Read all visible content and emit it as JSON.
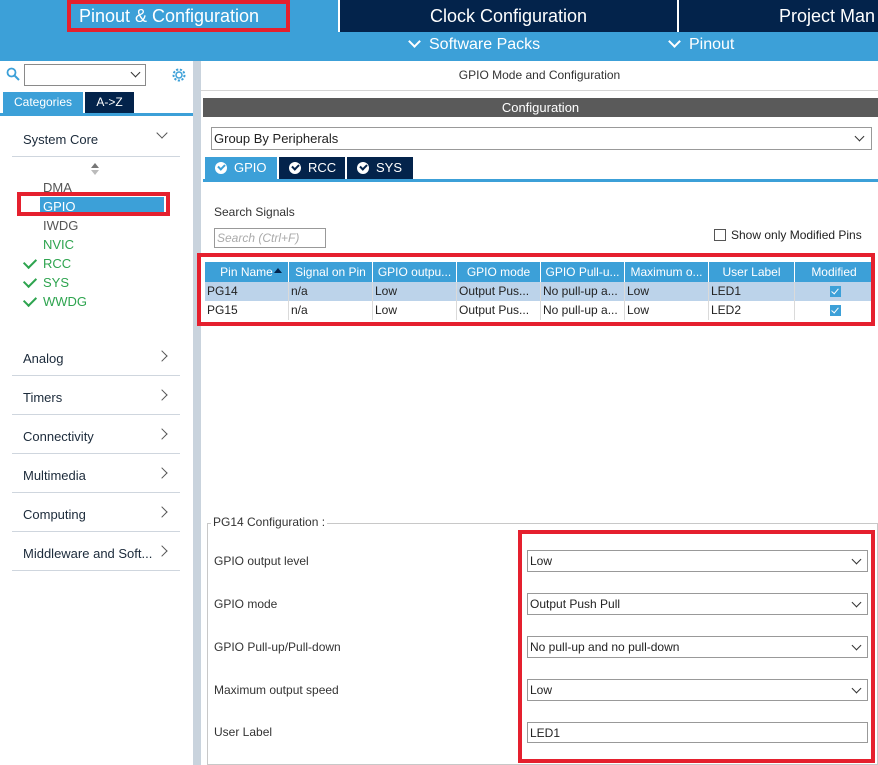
{
  "top_tabs": [
    {
      "label": "Pinout & Configuration"
    },
    {
      "label": "Clock Configuration"
    },
    {
      "label": "Project Man"
    }
  ],
  "sub_menu": {
    "software_packs": "Software Packs",
    "pinout": "Pinout"
  },
  "left_panel": {
    "search_value": "",
    "tab_categories": "Categories",
    "tab_az": "A->Z",
    "system_core": "System Core",
    "system_core_items": [
      "DMA",
      "GPIO",
      "IWDG",
      "NVIC",
      "RCC",
      "SYS",
      "WWDG"
    ],
    "sections": [
      "Analog",
      "Timers",
      "Connectivity",
      "Multimedia",
      "Computing",
      "Middleware and Soft..."
    ]
  },
  "right_panel": {
    "title": "GPIO Mode and Configuration",
    "config_header": "Configuration",
    "group_by": "Group By Peripherals",
    "peripheral_tabs": [
      "GPIO",
      "RCC",
      "SYS"
    ],
    "search_signals_label": "Search Signals",
    "search_placeholder": "Search (Ctrl+F)",
    "show_modified_label": "Show only Modified Pins",
    "table": {
      "headers": [
        "Pin Name",
        "Signal on Pin",
        "GPIO outpu...",
        "GPIO mode",
        "GPIO Pull-u...",
        "Maximum o...",
        "User Label",
        "Modified"
      ],
      "rows": [
        [
          "PG14",
          "n/a",
          "Low",
          "Output Pus...",
          "No pull-up a...",
          "Low",
          "LED1"
        ],
        [
          "PG15",
          "n/a",
          "Low",
          "Output Pus...",
          "No pull-up a...",
          "Low",
          "LED2"
        ]
      ]
    },
    "pin_config": {
      "legend": "PG14 Configuration :",
      "labels": [
        "GPIO output level",
        "GPIO mode",
        "GPIO Pull-up/Pull-down",
        "Maximum output speed",
        "User Label"
      ],
      "values": [
        "Low",
        "Output Push Pull",
        "No pull-up and no pull-down",
        "Low",
        "LED1"
      ]
    }
  },
  "colors": {
    "accent": "#3ca0d8",
    "dark_navy": "#03234b",
    "highlight": "#e5202e",
    "ok_green": "#2ea44f"
  }
}
